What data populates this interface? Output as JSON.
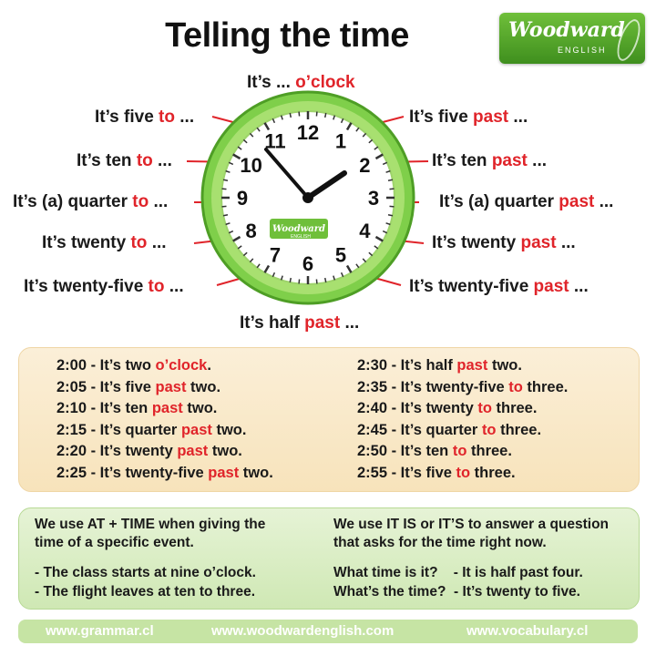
{
  "title": "Telling the time",
  "logo": {
    "main": "Woodward",
    "sub": "ENGLISH"
  },
  "clock_labels": {
    "top": [
      "It’s ... ",
      "o’clock"
    ],
    "five_to": [
      "It’s five ",
      "to",
      " ..."
    ],
    "five_past": [
      "It’s five ",
      "past",
      " ..."
    ],
    "ten_to": [
      "It’s ten ",
      "to",
      " ..."
    ],
    "ten_past": [
      "It’s ten ",
      "past",
      " ..."
    ],
    "quarter_to": [
      "It’s (a) quarter ",
      "to",
      " ..."
    ],
    "quarter_past": [
      "It’s (a) quarter ",
      "past",
      " ..."
    ],
    "twenty_to": [
      "It’s twenty ",
      "to",
      " ..."
    ],
    "twenty_past": [
      "It’s twenty ",
      "past",
      " ..."
    ],
    "twentyfive_to": [
      "It’s twenty-five ",
      "to",
      " ..."
    ],
    "twentyfive_past": [
      "It’s twenty-five ",
      "past",
      " ..."
    ],
    "half_past": [
      "It’s half ",
      "past",
      " ..."
    ]
  },
  "clock": {
    "numbers": [
      "12",
      "1",
      "2",
      "3",
      "4",
      "5",
      "6",
      "7",
      "8",
      "9",
      "10",
      "11"
    ],
    "face_logo": "Woodward",
    "face_logo_sub": "ENGLISH",
    "ring_color": "#6fc23c",
    "accent": "#e0242a"
  },
  "times_left": [
    [
      "2:00 - It’s two ",
      "o’clock",
      "."
    ],
    [
      "2:05 - It’s five ",
      "past",
      " two."
    ],
    [
      "2:10 - It’s ten ",
      "past",
      " two."
    ],
    [
      "2:15 - It’s quarter ",
      "past",
      " two."
    ],
    [
      "2:20 - It’s twenty ",
      "past",
      " two."
    ],
    [
      "2:25 - It’s twenty-five ",
      "past",
      " two."
    ]
  ],
  "times_right": [
    [
      "2:30 - It’s half ",
      "past",
      " two."
    ],
    [
      "2:35 - It’s twenty-five ",
      "to",
      " three."
    ],
    [
      "2:40 - It’s twenty ",
      "to",
      " three."
    ],
    [
      "2:45 - It’s quarter ",
      "to",
      " three."
    ],
    [
      "2:50 - It’s ten ",
      "to",
      " three."
    ],
    [
      "2:55 - It’s five ",
      "to",
      " three."
    ]
  ],
  "usage": {
    "left_intro_1": "We use AT + TIME when giving the",
    "left_intro_2": "time of a specific event.",
    "left_ex_1": "- The class starts at nine o’clock.",
    "left_ex_2": "- The flight leaves at ten to three.",
    "right_intro_1": "We use IT IS or IT’S to answer a question",
    "right_intro_2": "that asks for the time right now.",
    "right_ex_1": "What time is it?    - It is half past four.",
    "right_ex_2": "What’s the time?  - It’s twenty to five."
  },
  "footer": [
    "www.grammar.cl",
    "www.woodwardenglish.com",
    "www.vocabulary.cl"
  ]
}
